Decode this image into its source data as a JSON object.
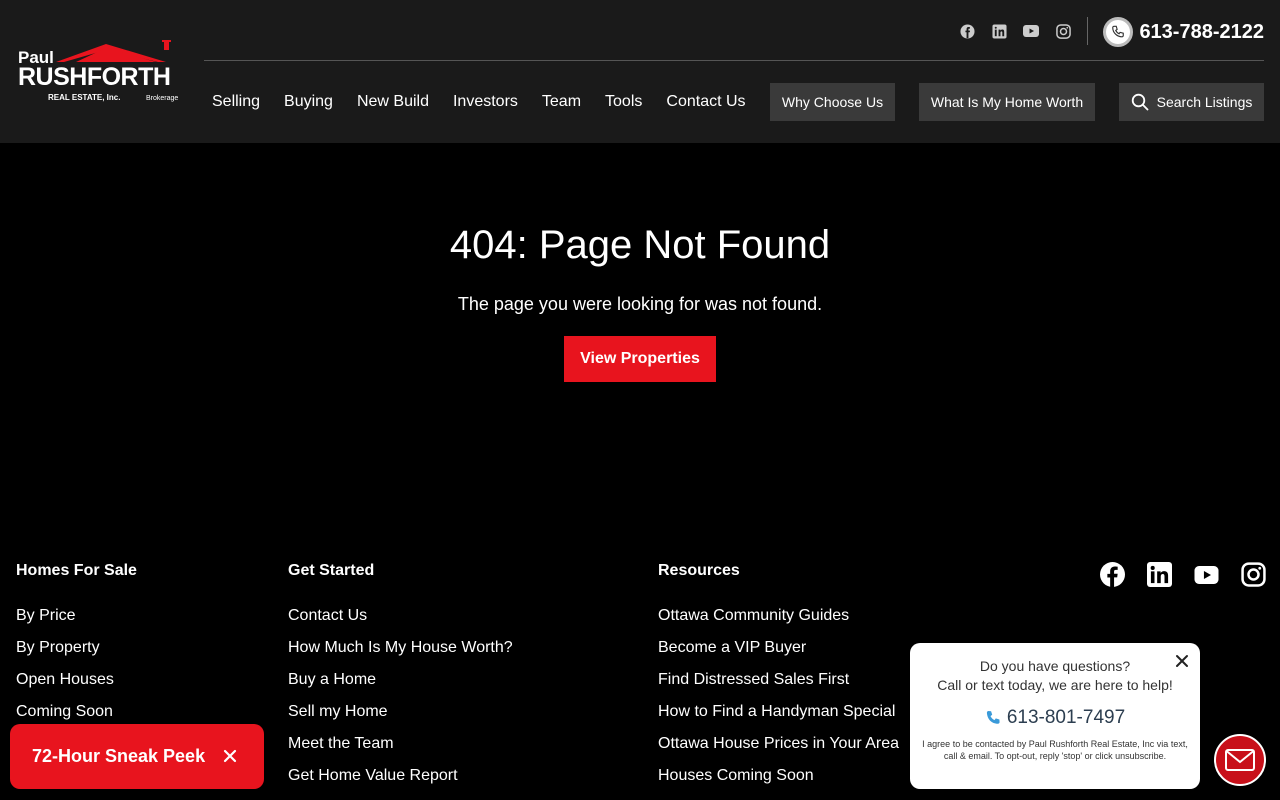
{
  "brand": {
    "line1": "Paul",
    "line2": "RUSHFORTH",
    "line3": "REAL ESTATE, Inc.",
    "line4": "Brokerage",
    "accent": "#e8141e"
  },
  "header": {
    "social_icons": [
      "facebook-icon",
      "linkedin-icon",
      "youtube-icon",
      "instagram-icon"
    ],
    "phone": "613-788-2122",
    "nav": [
      "Selling",
      "Buying",
      "New Build",
      "Investors",
      "Team",
      "Tools",
      "Contact Us"
    ],
    "why_choose": "Why Choose Us",
    "home_worth": "What Is My Home Worth",
    "search": "Search Listings"
  },
  "main": {
    "title": "404: Page Not Found",
    "subtitle": "The page you were looking for was not found.",
    "cta": "View Properties"
  },
  "footer": {
    "col1": {
      "title": "Homes For Sale",
      "links": [
        "By Price",
        "By Property",
        "Open Houses",
        "Coming Soon"
      ]
    },
    "col2": {
      "title": "Get Started",
      "links": [
        "Contact Us",
        "How Much Is My House Worth?",
        "Buy a Home",
        "Sell my Home",
        "Meet the Team",
        "Get Home Value Report"
      ]
    },
    "col3": {
      "title": "Resources",
      "links": [
        "Ottawa Community Guides",
        "Become a VIP Buyer",
        "Find Distressed Sales First",
        "How to Find a Handyman Special",
        "Ottawa House Prices in Your Area",
        "Houses Coming Soon"
      ]
    },
    "social_icons": [
      "facebook-icon",
      "linkedin-icon",
      "youtube-icon",
      "instagram-icon"
    ]
  },
  "sneak_peek": {
    "label": "72-Hour Sneak Peek"
  },
  "chat": {
    "line1": "Do you have questions?",
    "line2": "Call or text today, we are here to help!",
    "phone": "613-801-7497",
    "legal": "I agree to be contacted by Paul Rushforth Real Estate, Inc via text, call & email. To opt-out, reply 'stop' or click unsubscribe."
  }
}
